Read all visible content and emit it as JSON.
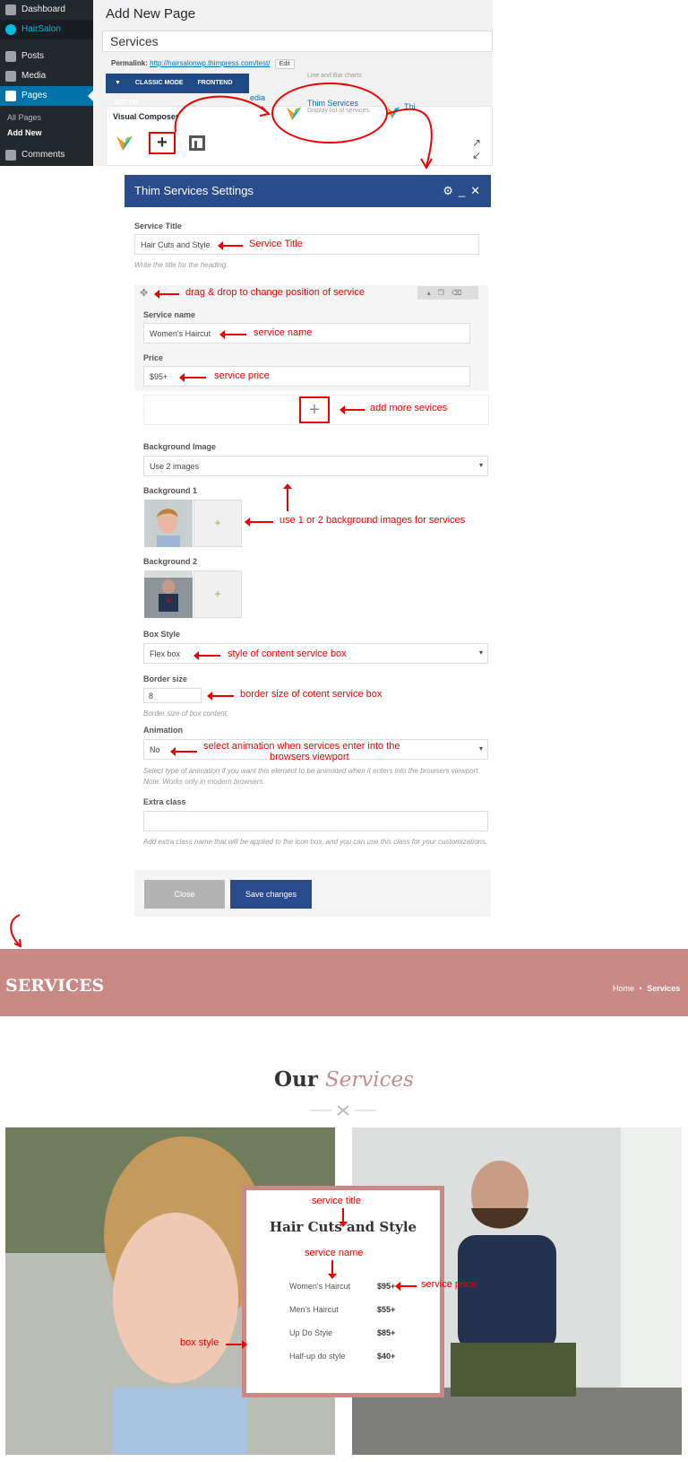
{
  "wp": {
    "sidebar": {
      "dashboard": "Dashboard",
      "brand": "HairSalon",
      "posts": "Posts",
      "media": "Media",
      "pages": "Pages",
      "all_pages": "All Pages",
      "add_new": "Add New",
      "comments": "Comments"
    },
    "heading": "Add New Page",
    "title_value": "Services",
    "permalink_label": "Permalink:",
    "permalink_url": "http://hairsalonwp.thimpress.com/test/",
    "permalink_edit": "Edit",
    "classic_mode": "CLASSIC MODE",
    "frontend_editor": "FRONTEND EDITOR",
    "visual_composer": "Visual Composer",
    "line_bar_hint": "Line and Bar charts",
    "popup_name": "Thim Services",
    "popup_desc": "Display list of services.",
    "popup_next": "Thi",
    "popup_prev": "edia"
  },
  "settings": {
    "header": "Thim Services Settings",
    "service_title_label": "Service Title",
    "service_title_value": "Hair Cuts and Style",
    "service_title_hint": "Write the title for the heading.",
    "service_name_label": "Service name",
    "service_name_value": "Women's Haircut",
    "price_label": "Price",
    "price_value": "$95+",
    "bg_image_label": "Background Image",
    "bg_image_value": "Use 2 images",
    "bg1_label": "Background 1",
    "bg2_label": "Background 2",
    "add_symbol": "+",
    "box_style_label": "Box Style",
    "box_style_value": "Flex box",
    "border_size_label": "Border size",
    "border_size_value": "8",
    "border_size_hint": "Border size of box content.",
    "animation_label": "Animation",
    "animation_value": "No",
    "animation_hint": "Select type of animation if you want this element to be animated when it enters into the browsers viewport. Note: Works only in modern browsers.",
    "extra_class_label": "Extra class",
    "extra_class_value": "",
    "extra_class_hint": "Add extra class name that will be applied to the icon box, and you can use this class for your customizations.",
    "close_button": "Close",
    "save_button": "Save changes"
  },
  "annotations": {
    "service_title": "Service Title",
    "drag_drop": "drag & drop to change position of service",
    "service_name": "service name",
    "service_price": "service price",
    "add_more": "add more sevices",
    "use_bg": "use 1 or 2 background images for services",
    "style_box": "style of content service box",
    "border_size": "border size of cotent service box",
    "animation_line1": "select animation when services enter into the",
    "animation_line2": "browsers viewport",
    "fe_service_title": "service title",
    "fe_service_name": "service name",
    "fe_service_price": "service price",
    "fe_box_style": "box style"
  },
  "frontend": {
    "banner_title": "SERVICES",
    "breadcrumb_home": "Home",
    "breadcrumb_sep": "•",
    "breadcrumb_current": "Services",
    "heading_plain": "Our",
    "heading_em": "Services",
    "box_title": "Hair Cuts and Style",
    "services": [
      {
        "name": "Women's Haircut",
        "price": "$95+"
      },
      {
        "name": "Men's Haircut",
        "price": "$55+"
      },
      {
        "name": "Up Do Style",
        "price": "$85+"
      },
      {
        "name": "Half-up do style",
        "price": "$40+"
      }
    ]
  },
  "colors": {
    "accent": "#c98a86",
    "header_blue": "#2b4c8c",
    "annotation_red": "#ee0000"
  }
}
